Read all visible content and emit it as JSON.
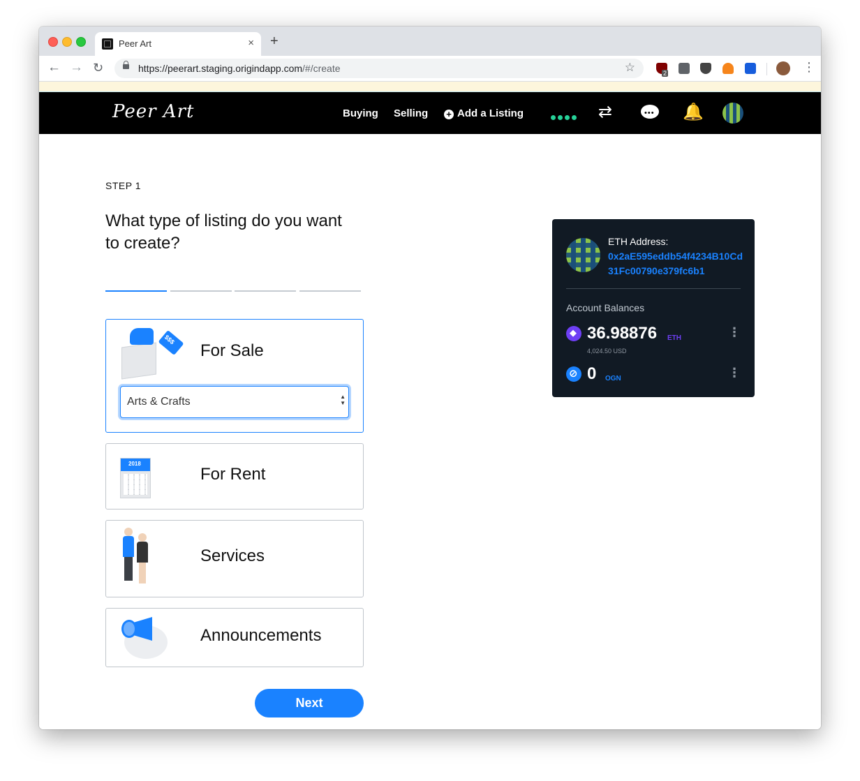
{
  "browser": {
    "tab_title": "Peer Art",
    "tab_close": "×",
    "new_tab": "+",
    "url_host": "https://peerart.staging.origindapp.com",
    "url_path": "/#/create",
    "extension_badge": "2",
    "icons": [
      "back-arrow-icon",
      "forward-arrow-icon",
      "reload-icon",
      "lock-icon",
      "star-icon",
      "shield-extension-icon",
      "download-extension-icon",
      "pocket-extension-icon",
      "metamask-fox-icon",
      "vault-extension-icon",
      "profile-avatar",
      "kebab-menu-icon"
    ]
  },
  "nav": {
    "logo": "Peer Art",
    "buying": "Buying",
    "selling": "Selling",
    "add_listing": "Add a Listing",
    "add_listing_icon": "+",
    "transfer_icon": "⇄",
    "bell_icon": "🔔"
  },
  "create": {
    "step": "STEP 1",
    "heading": "What type of listing do you want to create?",
    "progress": {
      "current_step": 1,
      "total_steps": 4
    },
    "cards": [
      {
        "label": "For Sale",
        "illustration": "for-sale-box-icon"
      },
      {
        "label": "For Rent",
        "illustration": "calendar-icon"
      },
      {
        "label": "Services",
        "illustration": "people-icon"
      },
      {
        "label": "Announcements",
        "illustration": "megaphone-icon"
      }
    ],
    "category_select": {
      "value": "Arts & Crafts"
    },
    "next_button": "Next"
  },
  "wallet": {
    "eth_label": "ETH Address:",
    "eth_address": "0x2aE595eddb54f4234B10Cd31Fc00790e379fc6b1",
    "balances_label": "Account Balances",
    "balances": [
      {
        "amount": "36.98876",
        "symbol": "ETH",
        "usd": "4,024.50 USD"
      },
      {
        "amount": "0",
        "symbol": "OGN"
      }
    ],
    "menu_glyph": "⋮"
  },
  "colors": {
    "accent": "#1a82ff",
    "nav_bg": "#000000",
    "wallet_bg": "#111a24",
    "status_green": "#26d198",
    "eth_purple": "#6e3ff5"
  }
}
